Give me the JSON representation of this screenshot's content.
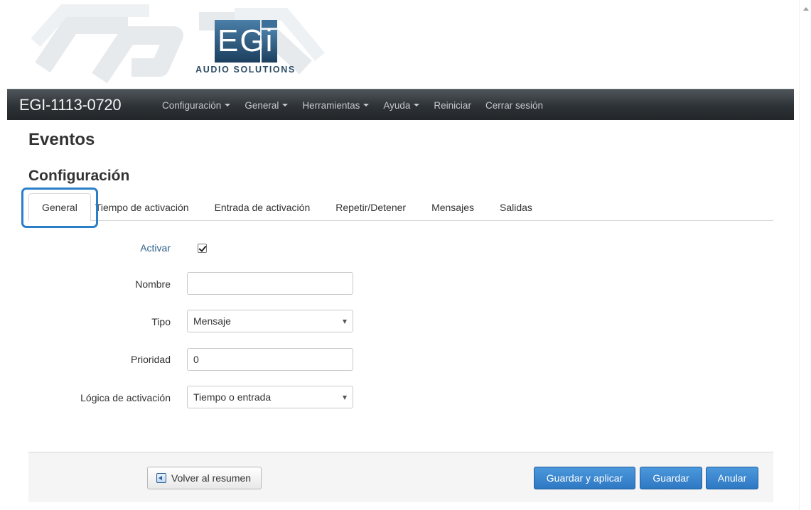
{
  "header": {
    "logo_mark": "EGi",
    "logo_subtitle": "AUDIO SOLUTIONS"
  },
  "navbar": {
    "brand": "EGI-1113-0720",
    "items": [
      {
        "label": "Configuración",
        "dropdown": true
      },
      {
        "label": "General",
        "dropdown": true
      },
      {
        "label": "Herramientas",
        "dropdown": true
      },
      {
        "label": "Ayuda",
        "dropdown": true
      },
      {
        "label": "Reiniciar",
        "dropdown": false
      },
      {
        "label": "Cerrar sesión",
        "dropdown": false
      }
    ]
  },
  "page": {
    "title": "Eventos",
    "section_title": "Configuración"
  },
  "tabs": [
    {
      "label": "General",
      "active": true
    },
    {
      "label": "Tiempo de activación",
      "active": false
    },
    {
      "label": "Entrada de activación",
      "active": false
    },
    {
      "label": "Repetir/Detener",
      "active": false
    },
    {
      "label": "Mensajes",
      "active": false
    },
    {
      "label": "Salidas",
      "active": false
    }
  ],
  "form": {
    "activar": {
      "label": "Activar",
      "checked": true
    },
    "nombre": {
      "label": "Nombre",
      "value": ""
    },
    "tipo": {
      "label": "Tipo",
      "value": "Mensaje"
    },
    "prioridad": {
      "label": "Prioridad",
      "value": "0"
    },
    "logica": {
      "label": "Lógica de activación",
      "value": "Tiempo o entrada"
    }
  },
  "footer": {
    "back_label": "Volver al resumen",
    "save_apply_label": "Guardar y aplicar",
    "save_label": "Guardar",
    "cancel_label": "Anular"
  },
  "colors": {
    "accent": "#2d78c2",
    "navbar": "#2d3236",
    "highlight": "#2b7fc8"
  }
}
